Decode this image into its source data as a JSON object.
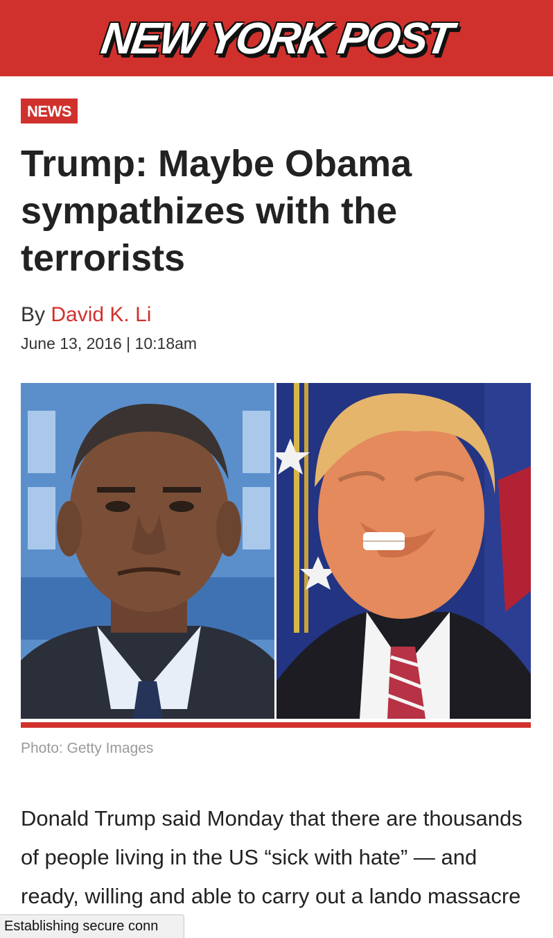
{
  "site": {
    "logo_text": "NEW YORK POST",
    "brand_color": "#d0312d"
  },
  "article": {
    "section": "NEWS",
    "headline": "Trump: Maybe Obama sympathizes with the terrorists",
    "byline_prefix": "By",
    "author": "David K. Li",
    "dateline": "June 13, 2016 | 10:18am",
    "photo_caption": "Photo: Getty Images",
    "body_preview": "Donald Trump said Monday that there are thousands of people living in the US “sick with hate” — and ready, willing and able to carry out a ",
    "body_cutoff": "lando massacre"
  },
  "browser": {
    "status_text": "Establishing secure conn"
  }
}
